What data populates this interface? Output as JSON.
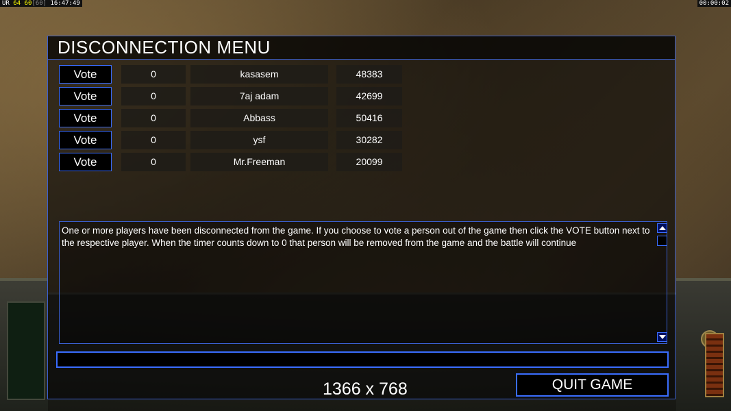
{
  "topbar": {
    "ur": "UR",
    "fps": "64 60",
    "fps_max": "[60]",
    "clock": "16:47:49",
    "game_time": "00:00:02"
  },
  "dialog": {
    "title": "DISCONNECTION MENU",
    "vote_label": "Vote",
    "players": [
      {
        "count": "0",
        "name": "kasasem",
        "ping": "48383"
      },
      {
        "count": "0",
        "name": "7aj adam",
        "ping": "42699"
      },
      {
        "count": "0",
        "name": "Abbass",
        "ping": "50416"
      },
      {
        "count": "0",
        "name": "ysf",
        "ping": "30282"
      },
      {
        "count": "0",
        "name": "Mr.Freeman",
        "ping": "20099"
      }
    ],
    "message": "One or more players have been disconnected from the game. If you choose to vote a person out of the game then click the VOTE  button next to the respective player. When the timer counts down to 0 that person will be removed from the game and the battle will continue",
    "chat_value": "",
    "quit_label": "QUIT GAME",
    "resolution": "1366 x 768"
  },
  "icons": {
    "scroll_up": "arrow-up-icon",
    "scroll_down": "arrow-down-icon",
    "rank": "star-icon"
  },
  "colors": {
    "accent_border": "#3a6dff",
    "fps": "#ffff00"
  }
}
